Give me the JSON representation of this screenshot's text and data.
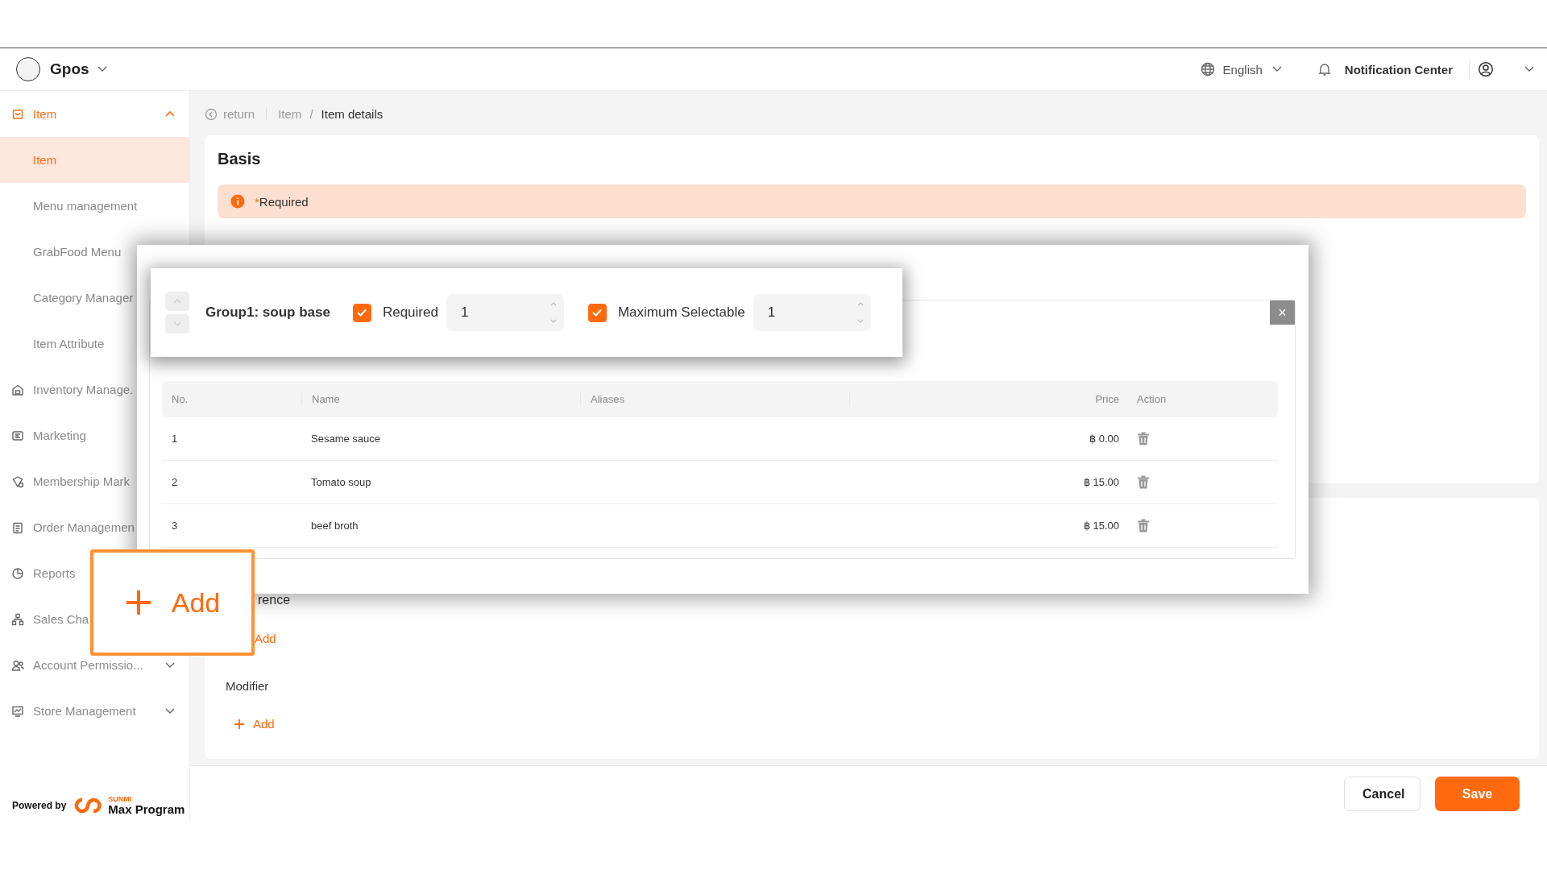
{
  "app": {
    "name": "Gpos"
  },
  "header": {
    "language": "English",
    "notification": "Notification Center"
  },
  "sidebar": {
    "items": [
      {
        "label": "Item",
        "kind": "group",
        "expanded": true,
        "children": [
          {
            "label": "Item",
            "selected": true
          },
          {
            "label": "Menu management",
            "selected": false
          },
          {
            "label": "GrabFood Menu",
            "selected": false
          },
          {
            "label": "Category Manager",
            "selected": false
          },
          {
            "label": "Item Attribute",
            "selected": false
          }
        ]
      },
      {
        "label": "Inventory Manage.",
        "kind": "link"
      },
      {
        "label": "Marketing",
        "kind": "link"
      },
      {
        "label": "Membership Mark",
        "kind": "link"
      },
      {
        "label": "Order Managemen",
        "kind": "link"
      },
      {
        "label": "Reports",
        "kind": "link"
      },
      {
        "label": "Sales Cha",
        "kind": "link"
      },
      {
        "label": "Account Permissio...",
        "kind": "group",
        "expanded": false
      },
      {
        "label": "Store Management",
        "kind": "group",
        "expanded": false
      }
    ],
    "powered_by": "Powered by",
    "brand_small": "SUNMI",
    "brand": "Max Program"
  },
  "breadcrumb": {
    "back": "return",
    "path": [
      "Item",
      "Item details"
    ],
    "separator": "/"
  },
  "basis": {
    "title": "Basis",
    "alert": {
      "mark": "*",
      "text": "Required"
    }
  },
  "modal": {
    "close": "×",
    "group": {
      "title": "Group1: soup base",
      "fields": [
        {
          "label": "Required",
          "checked": true,
          "value": "1"
        },
        {
          "label": "Maximum Selectable",
          "checked": true,
          "value": "1"
        }
      ]
    },
    "table": {
      "columns": [
        "No.",
        "Name",
        "Aliases",
        "Price",
        "Action"
      ],
      "rows": [
        {
          "no": "1",
          "name": "Sesame sauce",
          "price": "฿ 0.00"
        },
        {
          "no": "2",
          "name": "Tomato soup",
          "price": "฿ 15.00"
        },
        {
          "no": "3",
          "name": "beef broth",
          "price": "฿ 15.00"
        }
      ]
    }
  },
  "callout": {
    "label": "Add"
  },
  "preference": {
    "title": "rence",
    "add": "Add"
  },
  "modifier": {
    "title": "Modifier",
    "add": "Add"
  },
  "footer": {
    "buttons": [
      {
        "label": "Cancel",
        "kind": "secondary"
      },
      {
        "label": "Save",
        "kind": "primary"
      }
    ]
  }
}
